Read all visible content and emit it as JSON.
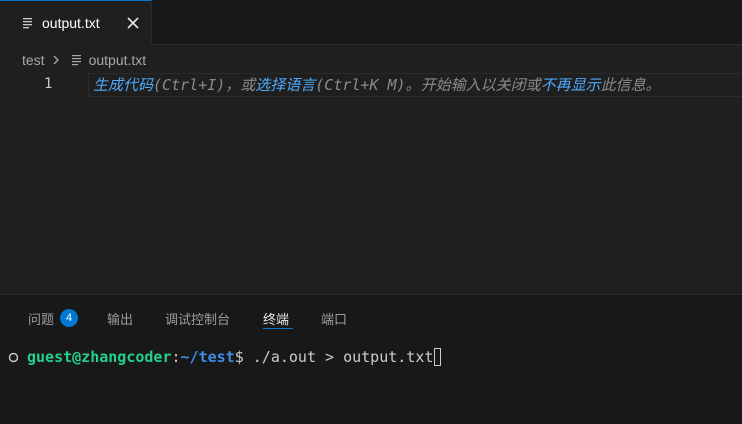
{
  "tabs": [
    {
      "label": "output.txt",
      "icon": "file-lines-icon",
      "active": true,
      "close_icon": "close-icon"
    }
  ],
  "breadcrumb": {
    "folder": "test",
    "file": "output.txt"
  },
  "editor": {
    "line_number": "1",
    "hint": {
      "generate_link": "生成代码",
      "generate_shortcut": "(Ctrl+I)，或",
      "select_link": "选择语言",
      "select_shortcut": "(Ctrl+K M)。开始输入以关闭或",
      "dismiss_link": "不再显示",
      "suffix": "此信息。"
    }
  },
  "panel": {
    "tabs": [
      {
        "label": "问题",
        "badge": "4"
      },
      {
        "label": "输出"
      },
      {
        "label": "调试控制台"
      },
      {
        "label": "终端",
        "active": true
      },
      {
        "label": "端口"
      }
    ],
    "terminal": {
      "user_host": "guest@zhangcoder",
      "colon": ":",
      "path": "~/test",
      "dollar": "$",
      "command": " ./a.out > output.txt"
    }
  },
  "colors": {
    "accent": "#0078d4",
    "link": "#4daafc",
    "prompt_user": "#23d18b",
    "prompt_path": "#3b8eea"
  }
}
